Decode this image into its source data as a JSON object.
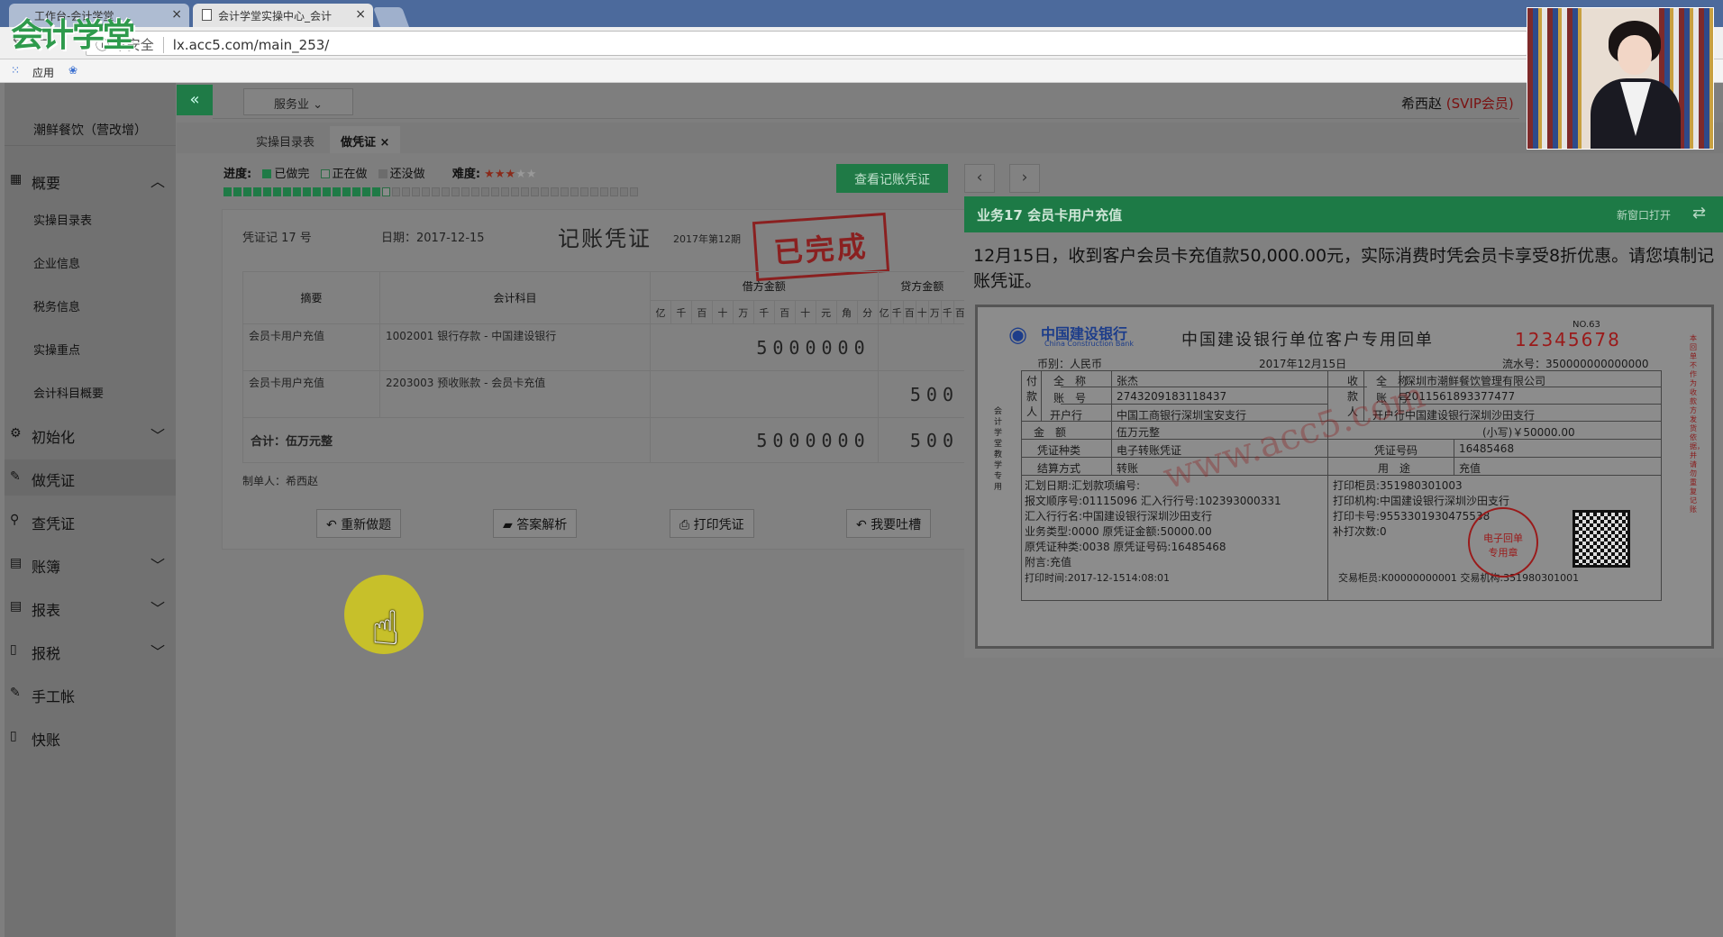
{
  "browser": {
    "tabs": [
      {
        "label": "工作台-会计学堂"
      },
      {
        "label": "会计学堂实操中心_会计"
      }
    ],
    "address": {
      "security": "不安全",
      "url": "lx.acc5.com/main_253/"
    },
    "bookmarks": {
      "apps": "应用"
    }
  },
  "logo": {
    "text": "会计学堂"
  },
  "app": {
    "company": "潮鲜餐饮（营改增）",
    "industry": "服务业",
    "user": {
      "name": "希西赵",
      "level": "(SVIP会员)"
    },
    "nav": [
      {
        "label": "概要",
        "icon": "grid-icon"
      },
      {
        "label": "初始化",
        "icon": "gear-icon"
      },
      {
        "label": "做凭证",
        "icon": "pen-icon"
      },
      {
        "label": "查凭证",
        "icon": "search-icon"
      },
      {
        "label": "账簿",
        "icon": "book-icon"
      },
      {
        "label": "报表",
        "icon": "report-icon"
      },
      {
        "label": "报税",
        "icon": "document-icon"
      },
      {
        "label": "手工帐",
        "icon": "pen-icon"
      },
      {
        "label": "快账",
        "icon": "document-icon"
      }
    ],
    "subnav": [
      "实操目录表",
      "企业信息",
      "税务信息",
      "实操重点",
      "会计科目概要"
    ],
    "page_tabs": [
      "实操目录表",
      "做凭证"
    ],
    "progress": {
      "label": "进度:",
      "done": "已做完",
      "doing": "正在做",
      "todo": "还没做",
      "difficulty": "难度:",
      "done_count": 16,
      "current": 17,
      "total": 42,
      "difficulty_level": 3,
      "difficulty_max": 5
    },
    "view_button": "查看记账凭证"
  },
  "voucher": {
    "number": "凭证记 17 号",
    "date": "日期：2017-12-15",
    "title": "记账凭证",
    "period": "2017年第12期",
    "stamp": "已完成",
    "headers": {
      "summary": "摘要",
      "account": "会计科目",
      "debit": "借方金额",
      "credit": "贷方金额"
    },
    "digit_units": [
      "亿",
      "千",
      "百",
      "十",
      "万",
      "千",
      "百",
      "十",
      "元",
      "角",
      "分"
    ],
    "credit_units": [
      "亿",
      "千",
      "百",
      "十",
      "万",
      "千",
      "百"
    ],
    "rows": [
      {
        "summary": "会员卡用户充值",
        "account": "1002001 银行存款 - 中国建设银行",
        "debit": "5000000",
        "credit": ""
      },
      {
        "summary": "会员卡用户充值",
        "account": "2203003 预收账款 - 会员卡充值",
        "debit": "",
        "credit": "500"
      }
    ],
    "total": {
      "label": "合计：伍万元整",
      "debit": "5000000",
      "credit": "500"
    },
    "maker": "制单人：希西赵",
    "buttons": [
      "重新做题",
      "答案解析",
      "打印凭证",
      "我要吐槽"
    ]
  },
  "task": {
    "title": "业务17 会员卡用户充值",
    "new_window": "新窗口打开",
    "description": "12月15日，收到客户会员卡充值款50,000.00元，实际消费时凭会员卡享受8折优惠。请您填制记账凭证。"
  },
  "receipt": {
    "bank_cn": "中国建设银行",
    "bank_en": "China Construction Bank",
    "title": "中国建设银行单位客户专用回单",
    "no_label": "NO.63",
    "serial": "12345678",
    "currency": "币别：人民币",
    "date": "2017年12月15日",
    "flow": "流水号：350000000000000",
    "payer_label": "付款人",
    "payee_label": "收款人",
    "fields": {
      "full_name": "全　称",
      "account": "账　号",
      "bank": "开户行",
      "payer_name": "张杰",
      "payer_account": "2743209183118437",
      "payer_bank": "中国工商银行深圳宝安支行",
      "payee_name": "深圳市潮鲜餐饮管理有限公司",
      "payee_account": "2011561893377477",
      "payee_bank": "中国建设银行深圳沙田支行",
      "amount_label": "金　额",
      "amount_cn": "伍万元整",
      "amount_small": "(小写)￥50000.00",
      "voucher_type_label": "凭证种类",
      "voucher_type": "电子转账凭证",
      "voucher_no_label": "凭证号码",
      "voucher_no": "16485468",
      "settle_label": "结算方式",
      "settle": "转账",
      "use_label": "用　途",
      "use": "充值"
    },
    "details_left": [
      "汇划日期:汇划款项编号:",
      "报文顺序号:01115096 汇入行行号:102393000331",
      "汇入行行名:中国建设银行深圳沙田支行",
      "业务类型:0000 原凭证金额:50000.00",
      "原凭证种类:0038 原凭证号码:16485468",
      "附言:充值"
    ],
    "details_right": [
      "打印柜员:351980301003",
      "打印机构:中国建设银行深圳沙田支行",
      "打印卡号:9553301930475538",
      "补打次数:0"
    ],
    "print_time": "打印时间:2017-12-1514:08:01",
    "teller": "交易柜员:K00000000001 交易机构:351980301001",
    "seal": "电子回单专用章",
    "side_label": "会计学堂教学专用",
    "right_note": "本回单不作为收款方发货依据，并请勿重复记账",
    "watermark": "www.acc5.com"
  },
  "colors": {
    "accent": "#1d7a46",
    "stamp": "#8a2020"
  }
}
